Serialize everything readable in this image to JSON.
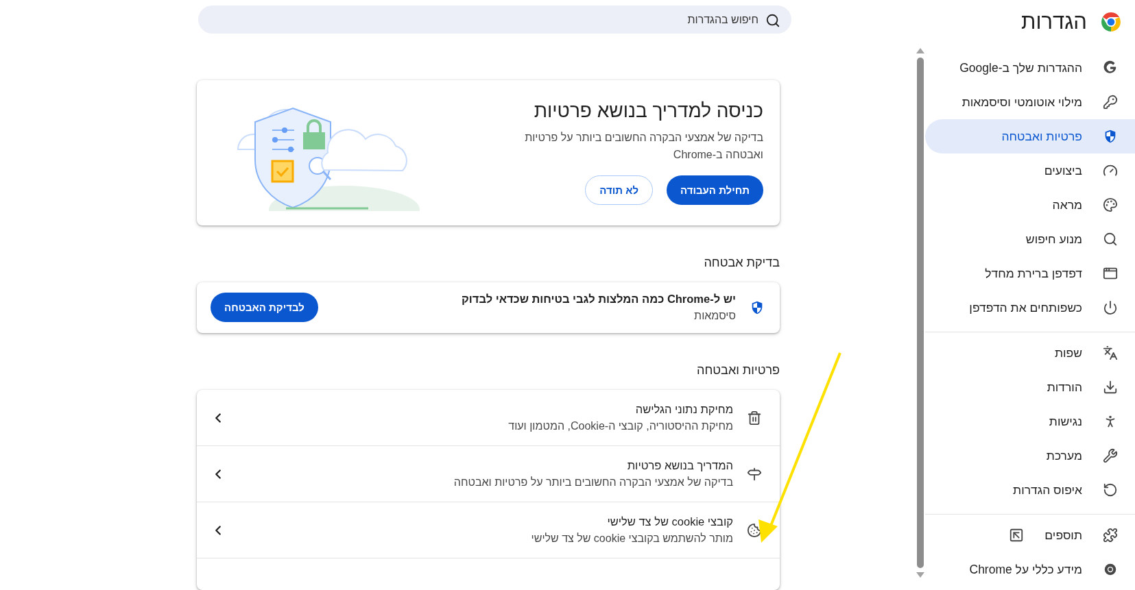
{
  "sidebar": {
    "title": "הגדרות",
    "groups": [
      {
        "items": [
          {
            "label": "ההגדרות שלך ב-Google",
            "selected": false,
            "external": false
          },
          {
            "label": "מילוי אוטומטי וסיסמאות",
            "selected": false,
            "external": false
          },
          {
            "label": "פרטיות ואבטחה",
            "selected": true,
            "external": false
          },
          {
            "label": "ביצועים",
            "selected": false,
            "external": false
          },
          {
            "label": "מראה",
            "selected": false,
            "external": false
          },
          {
            "label": "מנוע חיפוש",
            "selected": false,
            "external": false
          },
          {
            "label": "דפדפן ברירת מחדל",
            "selected": false,
            "external": false
          },
          {
            "label": "כשפותחים את הדפדפן",
            "selected": false,
            "external": false
          }
        ]
      },
      {
        "items": [
          {
            "label": "שפות",
            "selected": false,
            "external": false
          },
          {
            "label": "הורדות",
            "selected": false,
            "external": false
          },
          {
            "label": "נגישות",
            "selected": false,
            "external": false
          },
          {
            "label": "מערכת",
            "selected": false,
            "external": false
          },
          {
            "label": "איפוס הגדרות",
            "selected": false,
            "external": false
          }
        ]
      },
      {
        "items": [
          {
            "label": "תוספים",
            "selected": false,
            "external": true
          },
          {
            "label": "מידע כללי על Chrome",
            "selected": false,
            "external": false
          }
        ]
      }
    ]
  },
  "search": {
    "placeholder": "חיפוש בהגדרות"
  },
  "privacy_guide_card": {
    "title": "כניסה למדריך בנושא פרטיות",
    "description": "בדיקה של אמצעי הבקרה החשובים ביותר על פרטיות ואבטחה ב-Chrome",
    "buttons": [
      {
        "label": "תחילת העבודה",
        "kind": "primary"
      },
      {
        "label": "לא תודה",
        "kind": "outline"
      }
    ]
  },
  "safety_check": {
    "heading": "בדיקת אבטחה",
    "title": "יש ל-Chrome כמה המלצות לגבי בטיחות שכדאי לבדוק",
    "subtitle": "סיסמאות",
    "button": "לבדיקת האבטחה"
  },
  "privacy_section": {
    "heading": "פרטיות ואבטחה",
    "rows": [
      {
        "title": "מחיקת נתוני הגלישה",
        "subtitle": "מחיקת ההיסטוריה, קובצי ה-Cookie, המטמון ועוד"
      },
      {
        "title": "המדריך בנושא פרטיות",
        "subtitle": "בדיקה של אמצעי הבקרה החשובים ביותר על פרטיות ואבטחה"
      },
      {
        "title": "קובצי cookie של צד שלישי",
        "subtitle": "מותר להשתמש בקובצי cookie של צד שלישי"
      }
    ]
  }
}
